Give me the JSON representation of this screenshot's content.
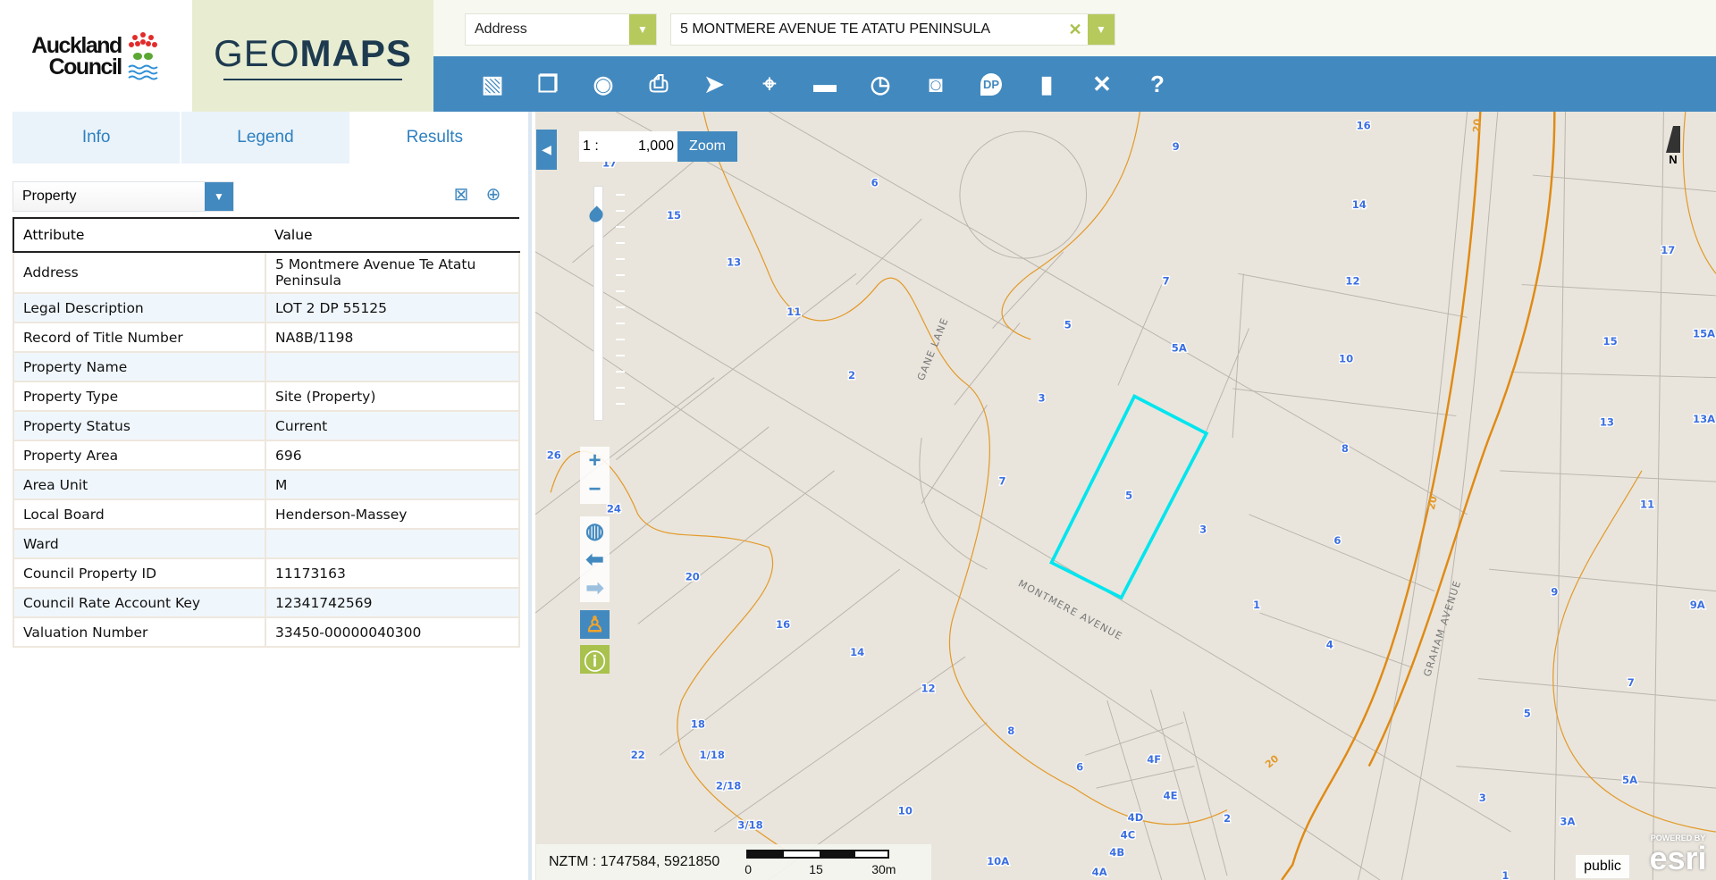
{
  "header": {
    "logo_text_line1": "Auckland",
    "logo_text_line2": "Council",
    "app_title_light": "GEO",
    "app_title_bold": "MAPS"
  },
  "search": {
    "type": "Address",
    "value": "5 MONTMERE AVENUE TE ATATU PENINSULA",
    "clear_icon": "x-icon"
  },
  "toolbar": {
    "tools": [
      "basemap-icon",
      "layers-icon",
      "eye-icon",
      "print-icon",
      "select-arrow-icon",
      "locate-target-icon",
      "measure-ruler-icon",
      "history-clock-icon",
      "camera-icon",
      "dp-marker-icon",
      "bookmark-icon",
      "tools-icon",
      "help-icon"
    ]
  },
  "panel": {
    "tabs": [
      {
        "label": "Info"
      },
      {
        "label": "Legend"
      },
      {
        "label": "Results",
        "active": true
      }
    ],
    "layer": "Property",
    "table": {
      "headers": [
        "Attribute",
        "Value"
      ],
      "rows": [
        [
          "Address",
          "5 Montmere Avenue Te Atatu Peninsula"
        ],
        [
          "Legal Description",
          "LOT 2 DP 55125"
        ],
        [
          "Record of Title Number",
          "NA8B/1198"
        ],
        [
          "Property Name",
          ""
        ],
        [
          "Property Type",
          "Site (Property)"
        ],
        [
          "Property Status",
          "Current"
        ],
        [
          "Property Area",
          "696"
        ],
        [
          "Area Unit",
          "M"
        ],
        [
          "Local Board",
          "Henderson-Massey"
        ],
        [
          "Ward",
          ""
        ],
        [
          "Council Property ID",
          "11173163"
        ],
        [
          "Council Rate Account Key",
          "12341742569"
        ],
        [
          "Valuation Number",
          "33450-00000040300"
        ]
      ]
    }
  },
  "map": {
    "scale_prefix": "1 :",
    "scale_value": "1,000",
    "zoom_label": "Zoom",
    "zoom_slider_level": 0.1,
    "north": "N",
    "coords": "NZTM : 1747584, 5921850",
    "scalebar": [
      "0",
      "15",
      "30m"
    ],
    "public": "public",
    "esri_powered": "POWERED BY",
    "esri": "esri",
    "selection_color": "#00e5ee",
    "contour_color": "#e39a2b",
    "roads": [
      "GANE LANE",
      "MONTMERE AVENUE",
      "GRAHAM AVENUE"
    ],
    "contour_labels": [
      "20",
      "20",
      "20"
    ],
    "lot_labels": [
      "16",
      "9",
      "6",
      "15",
      "14",
      "17",
      "13",
      "7",
      "12",
      "17",
      "11",
      "5",
      "5A",
      "10",
      "15",
      "15A",
      "2",
      "3",
      "13",
      "13A",
      "26",
      "8",
      "7",
      "5",
      "3",
      "11",
      "24",
      "6",
      "20",
      "9",
      "9A",
      "1",
      "16",
      "4",
      "14",
      "12",
      "7",
      "18",
      "8",
      "5",
      "22",
      "1/18",
      "4F",
      "6",
      "2/18",
      "4E",
      "5A",
      "3/18",
      "10",
      "4D",
      "2",
      "3",
      "4C",
      "4B",
      "3A",
      "10A",
      "4A",
      "1"
    ]
  }
}
